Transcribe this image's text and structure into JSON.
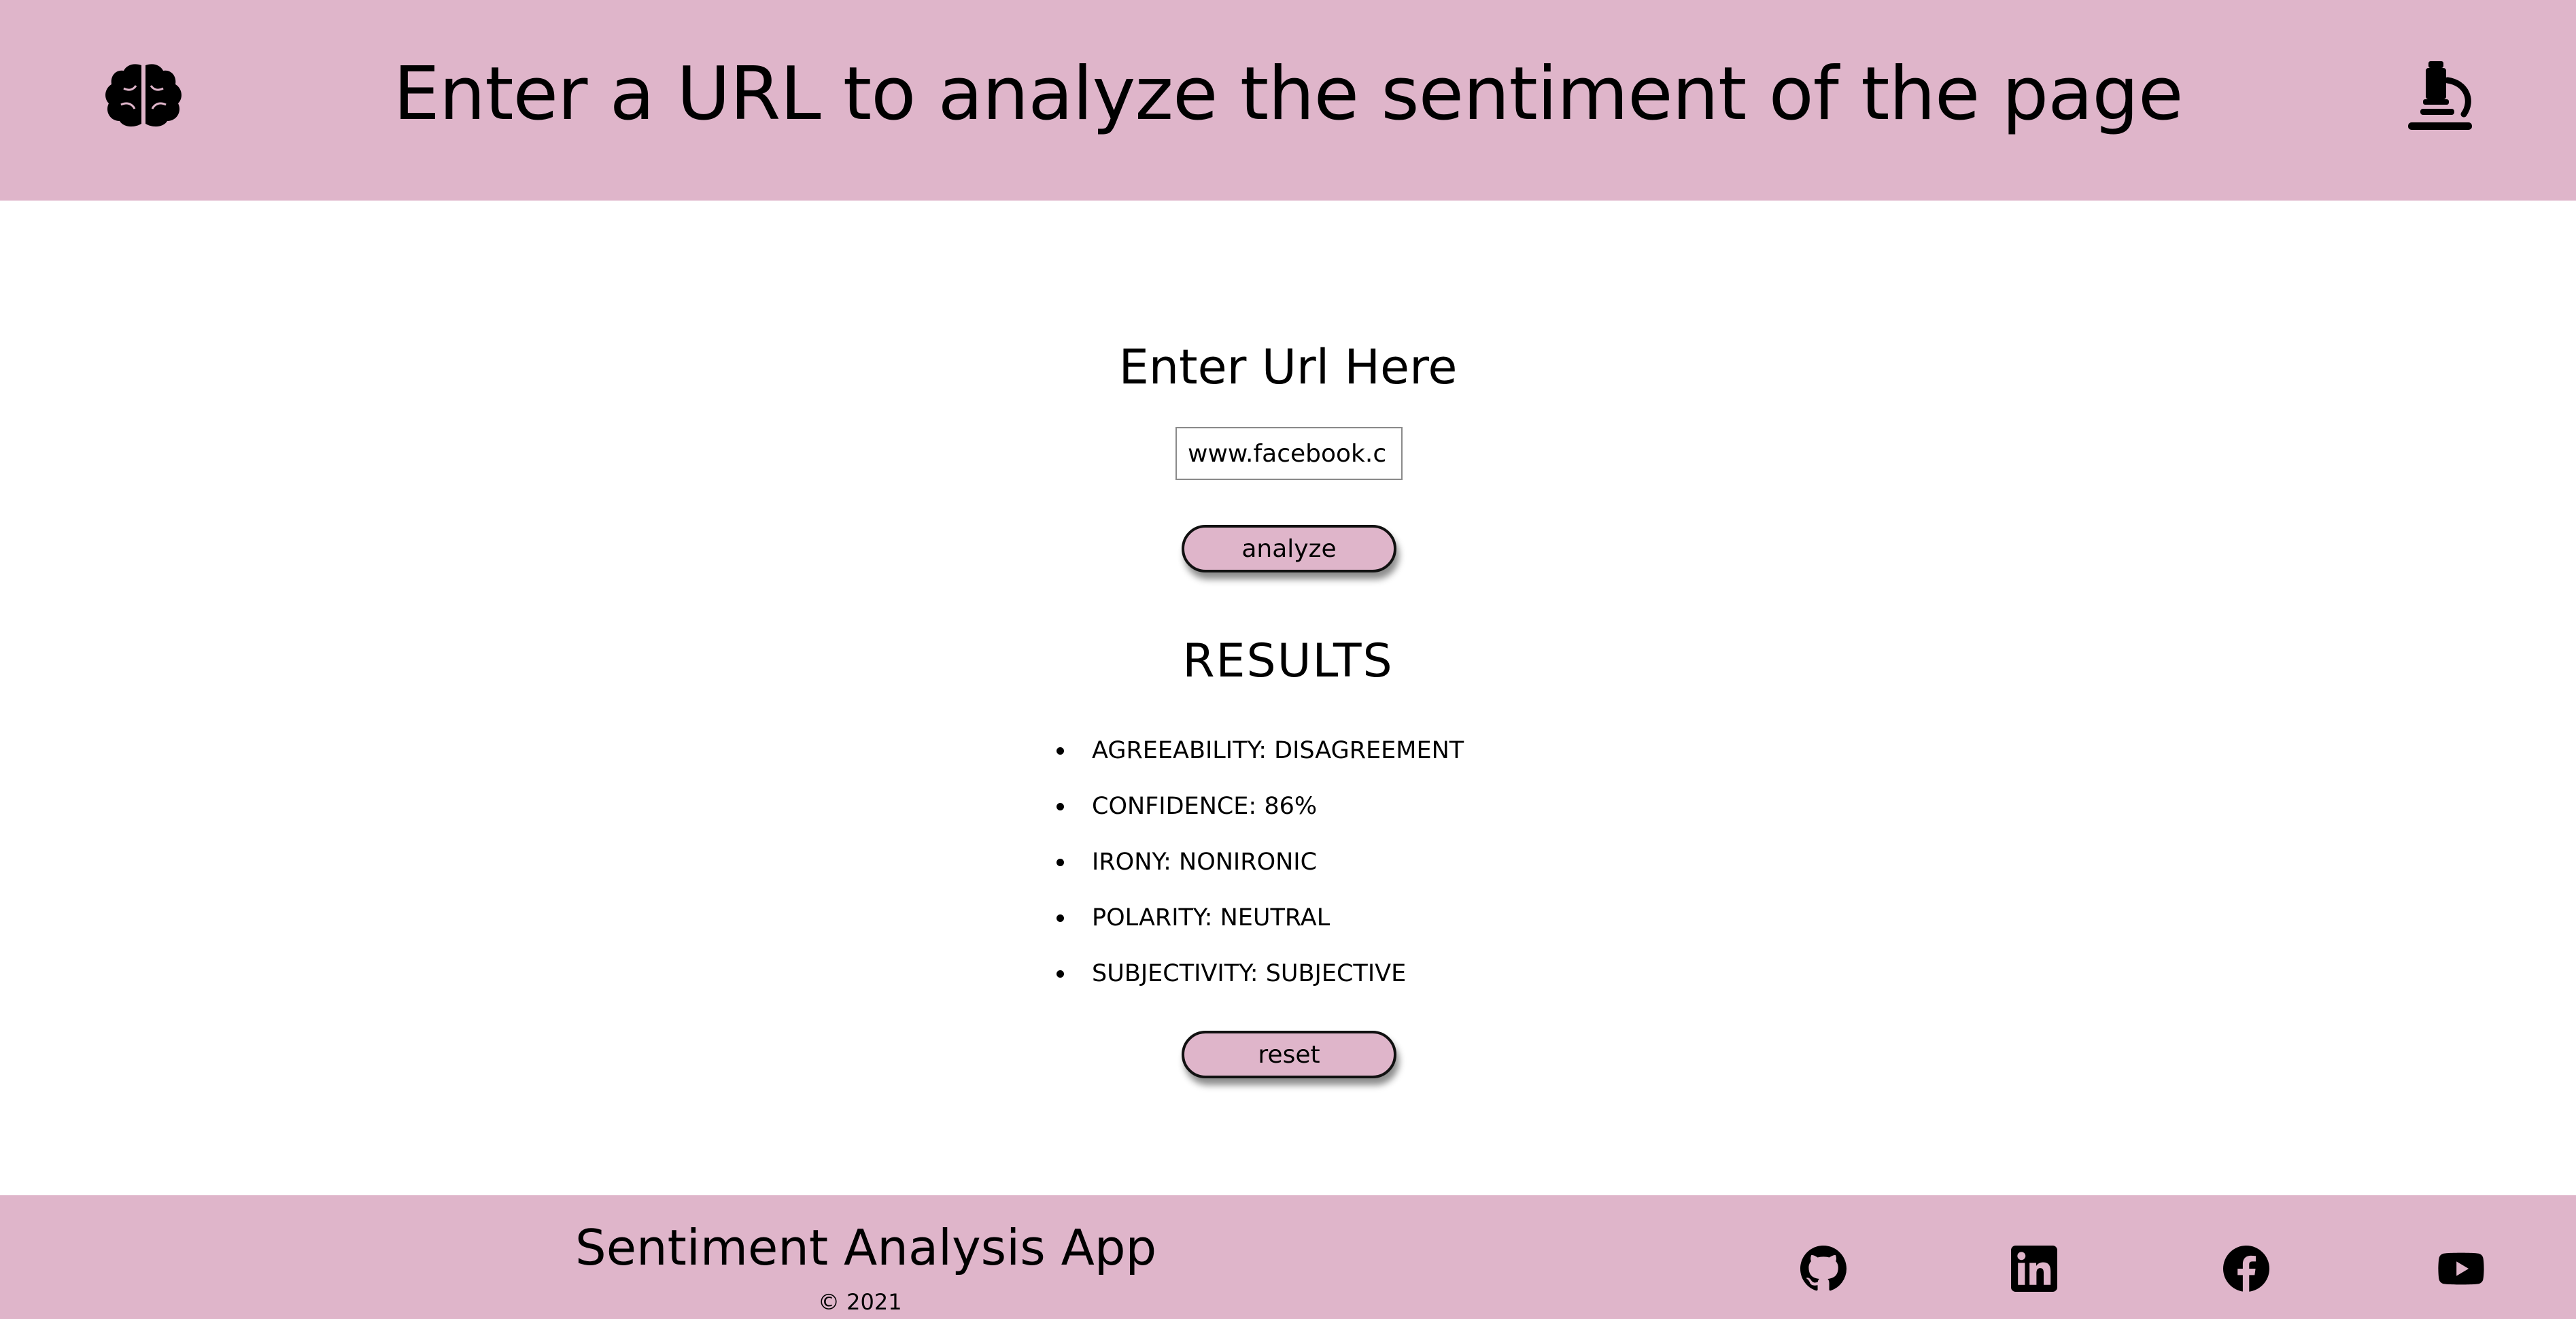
{
  "header": {
    "title": "Enter a URL to analyze the sentiment of the page",
    "left_icon": "brain-icon",
    "right_icon": "microscope-icon"
  },
  "form": {
    "heading": "Enter Url Here",
    "url_value": "www.facebook.c",
    "analyze_label": "analyze"
  },
  "results": {
    "heading": "RESULTS",
    "items": [
      "AGREEABILITY: DISAGREEMENT",
      "CONFIDENCE: 86%",
      "IRONY: NONIRONIC",
      "POLARITY: NEUTRAL",
      "SUBJECTIVITY: SUBJECTIVE"
    ],
    "reset_label": "reset"
  },
  "footer": {
    "title": "Sentiment Analysis App",
    "copyright": "© 2021",
    "social_icons": [
      "github-icon",
      "linkedin-icon",
      "facebook-icon",
      "youtube-icon"
    ]
  },
  "colors": {
    "accent": "#dfb5ca",
    "text": "#000000",
    "background": "#ffffff"
  }
}
